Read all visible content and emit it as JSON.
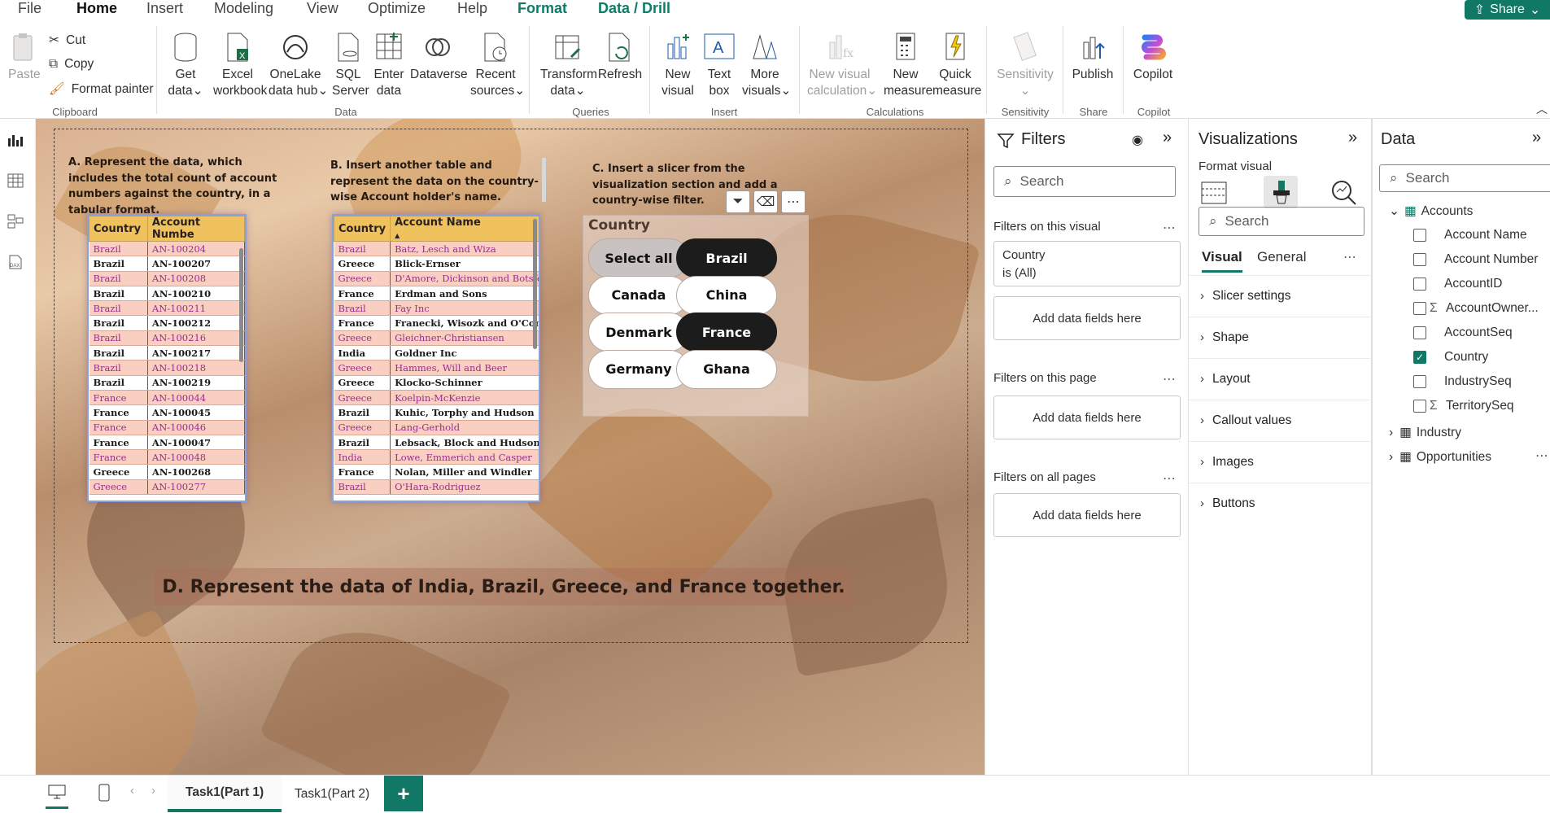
{
  "menu": {
    "items": [
      "File",
      "Home",
      "Insert",
      "Modeling",
      "View",
      "Optimize",
      "Help",
      "Format",
      "Data / Drill"
    ],
    "share_label": "Share"
  },
  "ribbon": {
    "clipboard": {
      "paste": "Paste",
      "cut": "Cut",
      "copy": "Copy",
      "format_painter": "Format painter",
      "group": "Clipboard"
    },
    "data": {
      "get_data": [
        "Get",
        "data"
      ],
      "excel": [
        "Excel",
        "workbook"
      ],
      "onelake": [
        "OneLake",
        "data hub"
      ],
      "sql": [
        "SQL",
        "Server"
      ],
      "enter": [
        "Enter",
        "data"
      ],
      "dataverse": [
        "Dataverse",
        ""
      ],
      "recent": [
        "Recent",
        "sources"
      ],
      "group": "Data"
    },
    "queries": {
      "transform": [
        "Transform",
        "data"
      ],
      "refresh": [
        "Refresh",
        ""
      ],
      "group": "Queries"
    },
    "insert": {
      "new_visual": [
        "New",
        "visual"
      ],
      "text_box": [
        "Text",
        "box"
      ],
      "more_visuals": [
        "More",
        "visuals"
      ],
      "group": "Insert"
    },
    "calculations": {
      "new_visual_calc": [
        "New visual",
        "calculation"
      ],
      "new_measure": [
        "New",
        "measure"
      ],
      "quick_measure": [
        "Quick",
        "measure"
      ],
      "group": "Calculations"
    },
    "sensitivity": {
      "label": "Sensitivity",
      "group": "Sensitivity"
    },
    "share": {
      "publish": "Publish",
      "group": "Share"
    },
    "copilot": {
      "label": "Copilot",
      "group": "Copilot"
    }
  },
  "canvas": {
    "task_a": "A. Represent the data, which includes the total count of account numbers against the country, in a tabular format.",
    "task_b": "B. Insert another table and represent the data on the country-wise Account holder's name.",
    "task_c": "C. Insert a slicer from the visualization section and add a country-wise filter.",
    "task_d": "D. Represent the data of India, Brazil, Greece, and France together.",
    "table_a": {
      "headers": [
        "Country",
        "Account Numbe"
      ],
      "rows": [
        [
          "Brazil",
          "AN-100204"
        ],
        [
          "Brazil",
          "AN-100207"
        ],
        [
          "Brazil",
          "AN-100208"
        ],
        [
          "Brazil",
          "AN-100210"
        ],
        [
          "Brazil",
          "AN-100211"
        ],
        [
          "Brazil",
          "AN-100212"
        ],
        [
          "Brazil",
          "AN-100216"
        ],
        [
          "Brazil",
          "AN-100217"
        ],
        [
          "Brazil",
          "AN-100218"
        ],
        [
          "Brazil",
          "AN-100219"
        ],
        [
          "France",
          "AN-100044"
        ],
        [
          "France",
          "AN-100045"
        ],
        [
          "France",
          "AN-100046"
        ],
        [
          "France",
          "AN-100047"
        ],
        [
          "France",
          "AN-100048"
        ],
        [
          "Greece",
          "AN-100268"
        ],
        [
          "Greece",
          "AN-100277"
        ]
      ]
    },
    "table_b": {
      "headers": [
        "Country",
        "Account Name"
      ],
      "rows": [
        [
          "Brazil",
          "Batz, Lesch and Wiza"
        ],
        [
          "Greece",
          "Blick-Ernser"
        ],
        [
          "Greece",
          "D'Amore, Dickinson and Botsfo"
        ],
        [
          "France",
          "Erdman and Sons"
        ],
        [
          "Brazil",
          "Fay Inc"
        ],
        [
          "France",
          "Franecki, Wisozk and O'Connell"
        ],
        [
          "Greece",
          "Gleichner-Christiansen"
        ],
        [
          "India",
          "Goldner Inc"
        ],
        [
          "Greece",
          "Hammes, Will and Beer"
        ],
        [
          "Greece",
          "Klocko-Schinner"
        ],
        [
          "Greece",
          "Koelpin-McKenzie"
        ],
        [
          "Brazil",
          "Kuhic, Torphy and Hudson"
        ],
        [
          "Greece",
          "Lang-Gerhold"
        ],
        [
          "Brazil",
          "Lebsack, Block and Hudson"
        ],
        [
          "India",
          "Lowe, Emmerich and Casper"
        ],
        [
          "France",
          "Nolan, Miller and Windler"
        ],
        [
          "Brazil",
          "O'Hara-Rodriguez"
        ]
      ]
    },
    "slicer": {
      "title": "Country",
      "options": [
        {
          "label": "Select all",
          "state": "all"
        },
        {
          "label": "Brazil",
          "state": "on"
        },
        {
          "label": "Canada",
          "state": "off"
        },
        {
          "label": "China",
          "state": "off"
        },
        {
          "label": "Denmark",
          "state": "off"
        },
        {
          "label": "France",
          "state": "on"
        },
        {
          "label": "Germany",
          "state": "off"
        },
        {
          "label": "Ghana",
          "state": "off"
        }
      ]
    }
  },
  "pages": {
    "tabs": [
      "Task1(Part 1)",
      "Task1(Part 2)"
    ],
    "active": 0,
    "add": "+"
  },
  "filters": {
    "title": "Filters",
    "search_placeholder": "Search",
    "on_visual": "Filters on this visual",
    "card_field": "Country",
    "card_value": "is (All)",
    "add_data": "Add data fields here",
    "on_page": "Filters on this page",
    "on_all": "Filters on all pages"
  },
  "visualizations": {
    "title": "Visualizations",
    "format_visual": "Format visual",
    "search_placeholder": "Search",
    "tabs": [
      "Visual",
      "General"
    ],
    "sections": [
      "Slicer settings",
      "Shape",
      "Layout",
      "Callout values",
      "Images",
      "Buttons"
    ]
  },
  "data_pane": {
    "title": "Data",
    "search_placeholder": "Search",
    "accounts": "Accounts",
    "fields": [
      {
        "name": "Account Name",
        "checked": false,
        "sigma": false
      },
      {
        "name": "Account Number",
        "checked": false,
        "sigma": false
      },
      {
        "name": "AccountID",
        "checked": false,
        "sigma": false
      },
      {
        "name": "AccountOwner...",
        "checked": false,
        "sigma": true
      },
      {
        "name": "AccountSeq",
        "checked": false,
        "sigma": false
      },
      {
        "name": "Country",
        "checked": true,
        "sigma": false
      },
      {
        "name": "IndustrySeq",
        "checked": false,
        "sigma": false
      },
      {
        "name": "TerritorySeq",
        "checked": false,
        "sigma": true
      }
    ],
    "tables": [
      "Industry",
      "Opportunities"
    ]
  }
}
